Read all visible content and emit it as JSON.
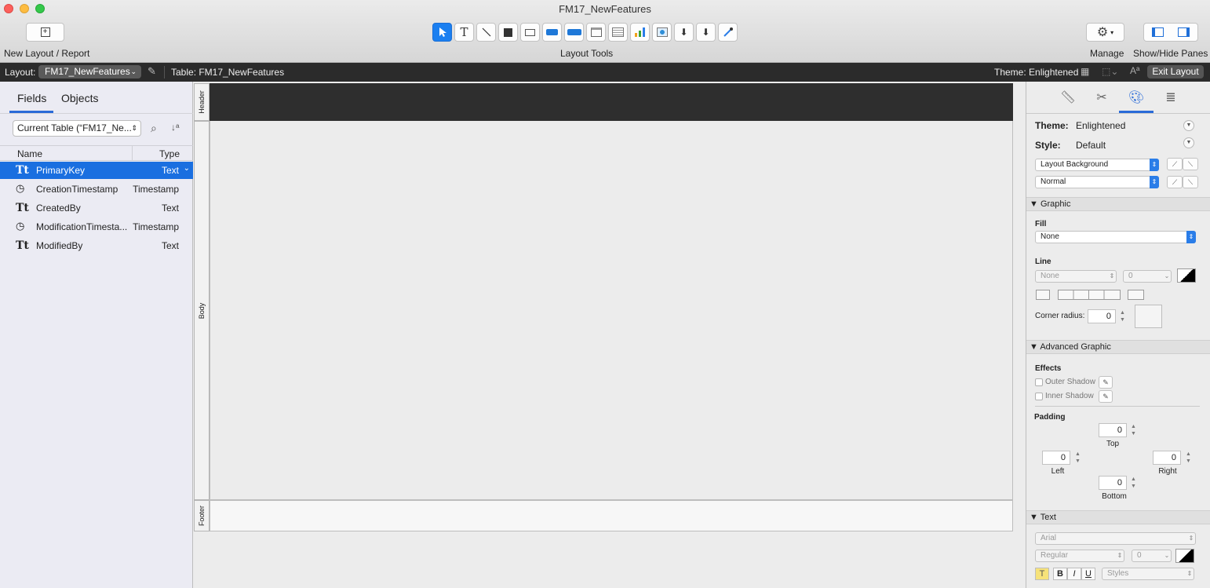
{
  "window": {
    "title": "FM17_NewFeatures"
  },
  "toolbar": {
    "new_layout_label": "New Layout / Report",
    "layout_tools_label": "Layout Tools",
    "manage_label": "Manage",
    "show_hide_label": "Show/Hide Panes"
  },
  "layout_bar": {
    "layout_label": "Layout:",
    "layout_name": "FM17_NewFeatures",
    "table_label": "Table: FM17_NewFeatures",
    "theme_label": "Theme: Enlightened",
    "exit_label": "Exit Layout"
  },
  "left_panel": {
    "tabs": [
      "Fields",
      "Objects"
    ],
    "table_select": "Current Table (“FM17_Ne...",
    "col_name": "Name",
    "col_type": "Type",
    "fields": [
      {
        "icon": "Tt",
        "name": "PrimaryKey",
        "type": "Text",
        "selected": true
      },
      {
        "icon": "clock",
        "name": "CreationTimestamp",
        "type": "Timestamp"
      },
      {
        "icon": "Tt",
        "name": "CreatedBy",
        "type": "Text"
      },
      {
        "icon": "clock",
        "name": "ModificationTimesta...",
        "type": "Timestamp"
      },
      {
        "icon": "Tt",
        "name": "ModifiedBy",
        "type": "Text"
      }
    ]
  },
  "canvas": {
    "parts": [
      "Header",
      "Body",
      "Footer"
    ]
  },
  "inspector": {
    "theme_label": "Theme:",
    "theme_value": "Enlightened",
    "style_label": "Style:",
    "style_value": "Default",
    "object_select": "Layout Background",
    "state_select": "Normal",
    "graphic_section": "Graphic",
    "fill_label": "Fill",
    "fill_value": "None",
    "line_label": "Line",
    "line_value": "None",
    "line_width": "0",
    "corner_radius_label": "Corner radius:",
    "corner_radius_value": "0",
    "advanced_section": "Advanced Graphic",
    "effects_label": "Effects",
    "outer_shadow": "Outer Shadow",
    "inner_shadow": "Inner Shadow",
    "padding_label": "Padding",
    "padding": {
      "top": "0",
      "left": "0",
      "right": "0",
      "bottom": "0"
    },
    "padding_labels": {
      "top": "Top",
      "left": "Left",
      "right": "Right",
      "bottom": "Bottom"
    },
    "text_section": "Text",
    "font_value": "Arial",
    "font_style_value": "Regular",
    "font_size_value": "0",
    "styles_value": "Styles"
  },
  "colors": {
    "accent": "#1b7ff0",
    "layout_bar": "#2b2b2b",
    "header_part": "#2e2e2e",
    "left_panel": "#ebebf3"
  }
}
